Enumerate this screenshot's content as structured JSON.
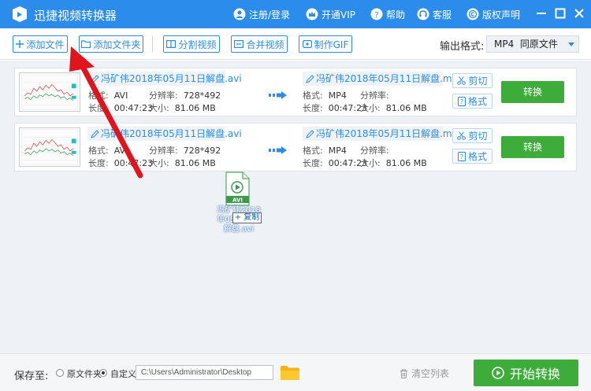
{
  "app": {
    "title": "迅捷视频转换器"
  },
  "titlebar": {
    "login": "注册/登录",
    "vip": "开通VIP",
    "help": "帮助",
    "service": "客服",
    "copyright": "版权声明"
  },
  "toolbar": {
    "add_file": "添加文件",
    "add_folder": "添加文件夹",
    "split_video": "分割视频",
    "merge_video": "合并视频",
    "make_gif": "制作GIF",
    "output_format_label": "输出格式:",
    "output_format_value": "MP4  同原文件"
  },
  "files": [
    {
      "src_name": "冯矿伟2018年05月11日解盘.avi",
      "src_format_label": "格式:",
      "src_format": "AVI",
      "src_res_label": "分辨率:",
      "src_res": "728*492",
      "src_len_label": "长度:",
      "src_len": "00:47:23",
      "src_size_label": "大小:",
      "src_size": "81.06 MB",
      "dst_name": "冯矿伟2018年05月11日解盘.m...",
      "dst_format_label": "格式:",
      "dst_format": "MP4",
      "dst_res_label": "分辨率:",
      "dst_res": "",
      "dst_len_label": "长度:",
      "dst_len": "00:47:23",
      "dst_size_label": "大小:",
      "dst_size": "81.06 MB",
      "cut": "剪切",
      "format": "格式",
      "convert": "转换"
    },
    {
      "src_name": "冯矿伟2018年05月11日解盘.avi",
      "src_format_label": "格式:",
      "src_format": "AVI",
      "src_res_label": "分辨率:",
      "src_res": "728*492",
      "src_len_label": "长度:",
      "src_len": "00:47:23",
      "src_size_label": "大小:",
      "src_size": "81.06 MB",
      "dst_name": "冯矿伟2018年05月11日解盘.m...",
      "dst_format_label": "格式:",
      "dst_format": "MP4",
      "dst_res_label": "分辨率:",
      "dst_res": "",
      "dst_len_label": "长度:",
      "dst_len": "00:47:23",
      "dst_size_label": "大小:",
      "dst_size": "81.06 MB",
      "cut": "剪切",
      "format": "格式",
      "convert": "转换"
    }
  ],
  "drag": {
    "file_type": "AVI",
    "file_name": "冯矿伟2018年05月11日解盘.avi",
    "copy_badge": "+ 复制"
  },
  "bottom": {
    "save_to": "保存至:",
    "opt_original": "原文件夹",
    "opt_custom": "自定义",
    "path": "C:\\Users\\Administrator\\Desktop",
    "clear_list": "清空列表",
    "start": "开始转换"
  },
  "colors": {
    "primary": "#2b8ceb",
    "green": "#3eac3a",
    "arrow": "#e0141c"
  }
}
